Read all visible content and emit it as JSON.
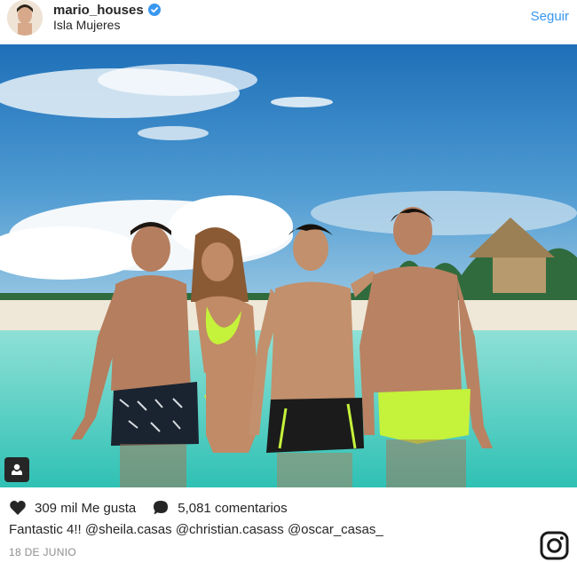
{
  "post": {
    "username": "mario_houses",
    "verified": true,
    "location": "Isla Mujeres",
    "follow_label": "Seguir",
    "likes": "309 mil Me gusta",
    "comments": "5,081 comentarios",
    "caption": {
      "text": "Fantastic 4!!",
      "mentions": [
        "@sheila.casas",
        "@christian.casass",
        "@oscar_casas_"
      ]
    },
    "date": "18 DE JUNIO"
  },
  "icons": {
    "verified": "verified-badge-icon",
    "tag": "user-tag-icon",
    "like": "heart-icon",
    "comment": "comment-bubble-icon",
    "logo": "instagram-logo-icon"
  },
  "colors": {
    "link_blue": "#3897f0",
    "verified_blue": "#3897f0",
    "text": "#262626",
    "muted": "#8e8e8e"
  }
}
